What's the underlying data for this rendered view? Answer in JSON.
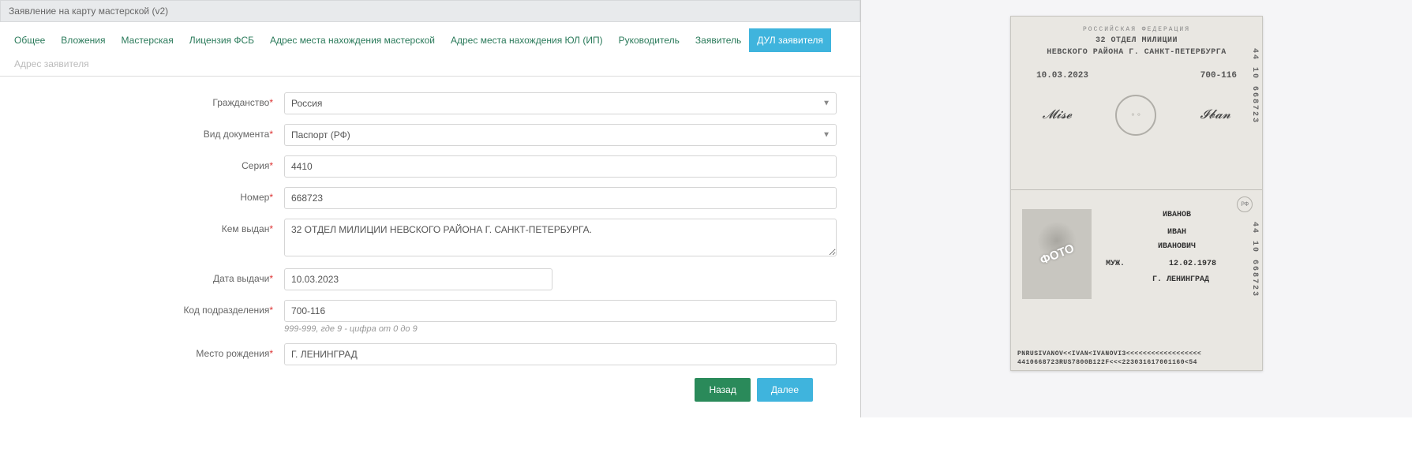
{
  "window_title": "Заявление на карту мастерской (v2)",
  "tabs": [
    {
      "label": "Общее"
    },
    {
      "label": "Вложения"
    },
    {
      "label": "Мастерская"
    },
    {
      "label": "Лицензия ФСБ"
    },
    {
      "label": "Адрес места нахождения мастерской"
    },
    {
      "label": "Адрес места нахождения ЮЛ (ИП)"
    },
    {
      "label": "Руководитель"
    },
    {
      "label": "Заявитель"
    },
    {
      "label": "ДУЛ заявителя"
    },
    {
      "label": "Адрес заявителя"
    }
  ],
  "labels": {
    "citizenship": "Гражданство",
    "doc_type": "Вид документа",
    "series": "Серия",
    "number": "Номер",
    "issued_by": "Кем выдан",
    "issue_date": "Дата выдачи",
    "dept_code": "Код подразделения",
    "birth_place": "Место рождения"
  },
  "values": {
    "citizenship": "Россия",
    "doc_type": "Паспорт (РФ)",
    "series": "4410",
    "number": "668723",
    "issued_by": "32 ОТДЕЛ МИЛИЦИИ НЕВСКОГО РАЙОНА Г. САНКТ-ПЕТЕРБУРГА.",
    "issue_date": "10.03.2023",
    "dept_code": "700-116",
    "birth_place": "Г. ЛЕНИНГРАД"
  },
  "help": {
    "dept_code": "999-999, где 9 - цифра от 0 до 9"
  },
  "buttons": {
    "back": "Назад",
    "next": "Далее"
  },
  "scan": {
    "header": "РОССИЙСКАЯ ФЕДЕРАЦИЯ",
    "issuer1": "32 ОТДЕЛ МИЛИЦИИ",
    "issuer2": "НЕВСКОГО РАЙОНА Г. САНКТ-ПЕТЕРБУРГА",
    "date": "10.03.2023",
    "code": "700-116",
    "side_top": "44 10 668723",
    "side_bot": "44 10 668723",
    "surname": "ИВАНОВ",
    "name": "ИВАН",
    "patronymic": "ИВАНОВИЧ",
    "sex": "МУЖ.",
    "dob": "12.02.1978",
    "pob": "Г. ЛЕНИНГРАД",
    "photo_label": "ФОТО",
    "mrz1": "PNRUSIVANOV<<IVAN<IVANOVI3<<<<<<<<<<<<<<<<<<",
    "mrz2": "4410668723RUS7800B122F<<<223031617001160<54"
  }
}
